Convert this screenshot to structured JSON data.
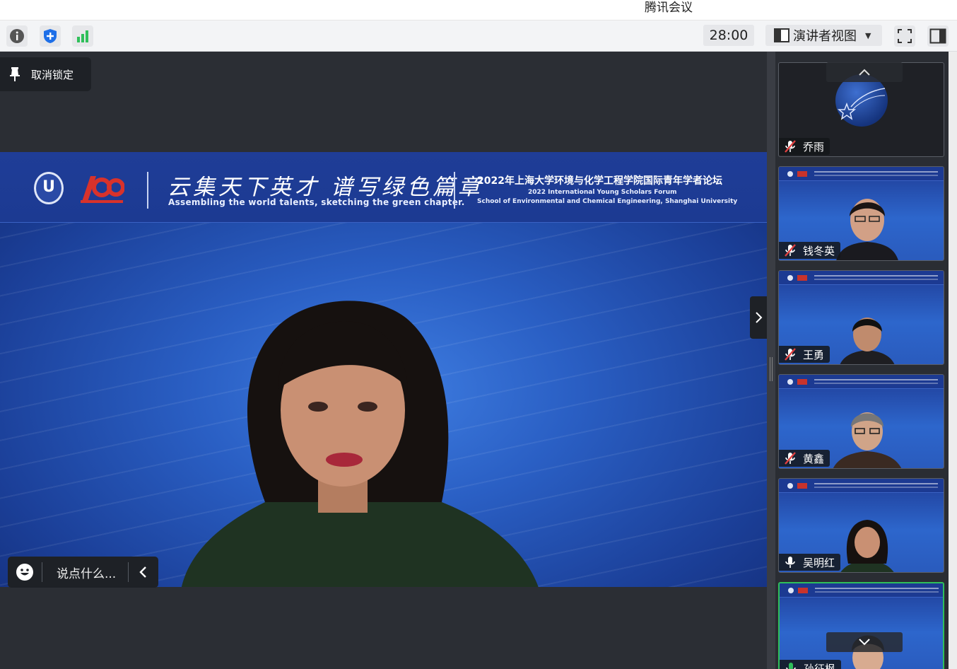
{
  "window": {
    "title": "腾讯会议"
  },
  "toolbar": {
    "info_icon": "info-icon",
    "shield_icon": "shield-icon",
    "signal_icon": "signal-icon",
    "timer": "28:00",
    "view_label": "演讲者视图",
    "fullscreen_icon": "fullscreen-icon",
    "sidebar_icon": "sidebar-toggle-icon"
  },
  "stage": {
    "unlock_label": "取消锁定",
    "banner": {
      "slogan_cn": "云集天下英才 谱写绿色篇章",
      "slogan_en": "Assembling the world talents, sketching the green chapter.",
      "forum_cn": "2022年上海大学环境与化学工程学院国际青年学者论坛",
      "forum_en_1": "2022 International Young Scholars Forum",
      "forum_en_2": "School of Environmental and Chemical Engineering, Shanghai University"
    },
    "chat_placeholder": "说点什么..."
  },
  "participants": [
    {
      "name": "乔雨",
      "mic": "muted",
      "video": "avatar"
    },
    {
      "name": "钱冬英",
      "mic": "muted",
      "video": "camera"
    },
    {
      "name": "王勇",
      "mic": "muted",
      "video": "camera"
    },
    {
      "name": "黄鑫",
      "mic": "muted",
      "video": "camera"
    },
    {
      "name": "吴明红",
      "mic": "on",
      "video": "camera"
    },
    {
      "name": "孙征枫",
      "mic": "speaking",
      "video": "camera"
    }
  ],
  "colors": {
    "accent_green": "#2fbf5a",
    "muted_red": "#e04040",
    "stage_bg": "#2b2e34"
  }
}
